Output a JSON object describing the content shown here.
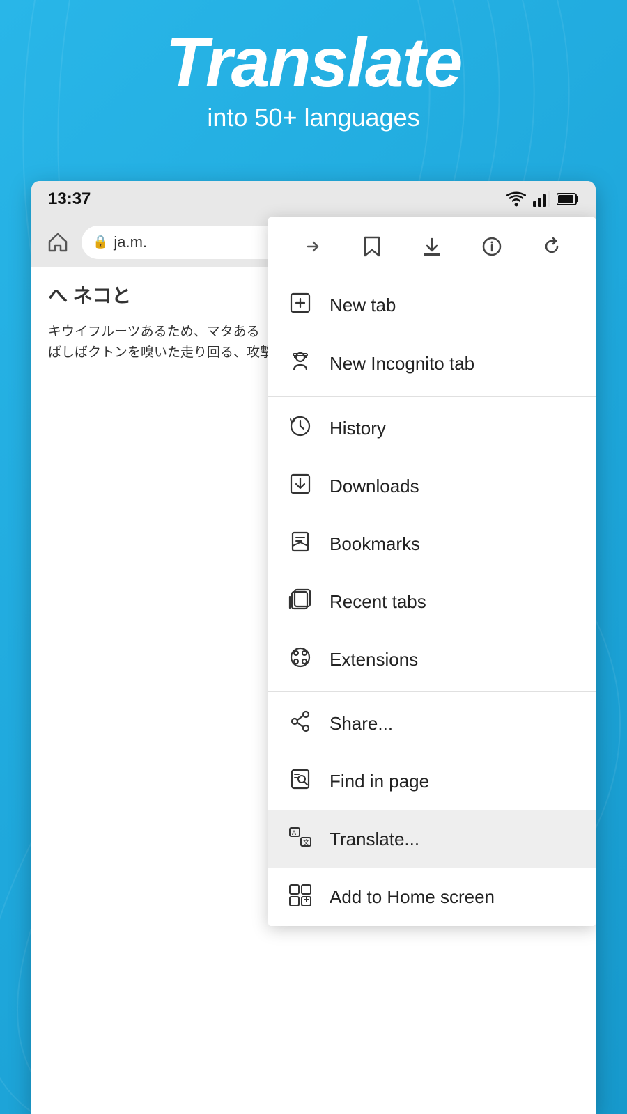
{
  "background": {
    "color": "#29b6e8"
  },
  "header": {
    "title": "Translate",
    "subtitle": "into 50+ languages"
  },
  "status_bar": {
    "time": "13:37",
    "wifi_icon": "wifi",
    "signal_icon": "signal",
    "battery_icon": "battery"
  },
  "address_bar": {
    "url_text": "ja.m.",
    "url_prefix": "🔒"
  },
  "page_content": {
    "title": "へ ネコと",
    "body_text": "キウイフルーツあるため、マタある「鋤鼻器」通じ、ネコを奥木にはしばしばクトンを嗅いた走り回る、攻撃"
  },
  "toolbar": {
    "forward_label": "→",
    "bookmark_label": "☆",
    "download_label": "⬇",
    "info_label": "ℹ",
    "reload_label": "↺"
  },
  "menu_items": [
    {
      "id": "new-tab",
      "label": "New tab",
      "icon": "new-tab-icon"
    },
    {
      "id": "new-incognito-tab",
      "label": "New Incognito tab",
      "icon": "incognito-icon"
    },
    {
      "id": "history",
      "label": "History",
      "icon": "history-icon"
    },
    {
      "id": "downloads",
      "label": "Downloads",
      "icon": "downloads-icon"
    },
    {
      "id": "bookmarks",
      "label": "Bookmarks",
      "icon": "bookmarks-icon"
    },
    {
      "id": "recent-tabs",
      "label": "Recent tabs",
      "icon": "recent-tabs-icon"
    },
    {
      "id": "extensions",
      "label": "Extensions",
      "icon": "extensions-icon"
    },
    {
      "id": "share",
      "label": "Share...",
      "icon": "share-icon"
    },
    {
      "id": "find-in-page",
      "label": "Find in page",
      "icon": "find-icon"
    },
    {
      "id": "translate",
      "label": "Translate...",
      "icon": "translate-icon",
      "active": true
    },
    {
      "id": "add-home",
      "label": "Add to Home screen",
      "icon": "add-home-icon"
    }
  ]
}
